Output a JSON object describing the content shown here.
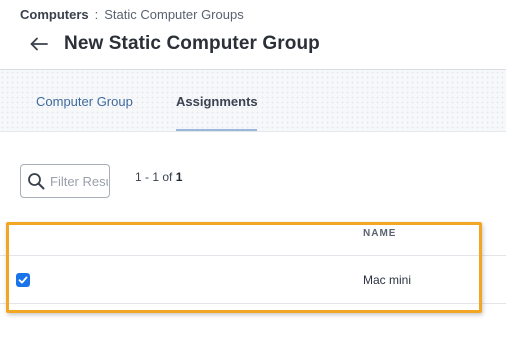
{
  "breadcrumb": {
    "root": "Computers",
    "separator": ":",
    "current": "Static Computer Groups"
  },
  "header": {
    "back_icon": "arrow-left-icon",
    "title": "New Static Computer Group"
  },
  "tabs": [
    {
      "label": "Computer Group",
      "active": false
    },
    {
      "label": "Assignments",
      "active": true
    }
  ],
  "filter": {
    "placeholder": "Filter Results",
    "value": "",
    "icon": "search-icon"
  },
  "pagination": {
    "range": "1 - 1 of",
    "total": "1"
  },
  "table": {
    "columns": [
      "",
      "NAME"
    ],
    "rows": [
      {
        "selected": true,
        "name": "Mac mini"
      }
    ]
  },
  "colors": {
    "highlight": "#f2a623",
    "checkbox": "#1a73e8",
    "active_tab_underline": "#9bb7dc",
    "link": "#3e6a9e"
  }
}
